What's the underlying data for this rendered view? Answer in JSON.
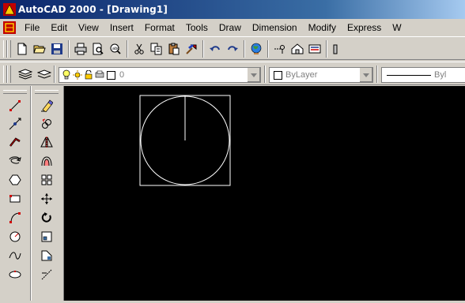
{
  "window": {
    "title": "AutoCAD 2000 - [Drawing1]"
  },
  "menu": {
    "items": [
      "File",
      "Edit",
      "View",
      "Insert",
      "Format",
      "Tools",
      "Draw",
      "Dimension",
      "Modify",
      "Express",
      "W"
    ]
  },
  "toolbar_standard": {
    "icons": [
      "new-file-icon",
      "open-folder-icon",
      "save-icon",
      "print-icon",
      "print-preview-icon",
      "plot-icon",
      "cut-icon",
      "copy-icon",
      "paste-icon",
      "match-properties-icon",
      "undo-icon",
      "redo-icon",
      "internet-icon",
      "snap-icon",
      "adcenter-icon",
      "properties-icon"
    ]
  },
  "toolbar_layers": {
    "layer_name": "0",
    "color_value": "ByLayer",
    "linetype_value": "Byl"
  },
  "draw_toolbar": {
    "icons": [
      "line-icon",
      "construction-line-icon",
      "polyline-icon",
      "polygon-icon",
      "rectangle-icon",
      "arc-icon",
      "circle-icon",
      "spline-icon",
      "ellipse-icon"
    ]
  },
  "modify_toolbar": {
    "icons": [
      "erase-icon",
      "copy-object-icon",
      "mirror-icon",
      "offset-icon",
      "array-icon",
      "move-icon",
      "rotate-icon",
      "scale-icon",
      "stretch-icon",
      "trim-icon"
    ]
  },
  "colors": {
    "titlebar_start": "#0a246a",
    "canvas": "#000000",
    "entity": "#ffffff"
  }
}
